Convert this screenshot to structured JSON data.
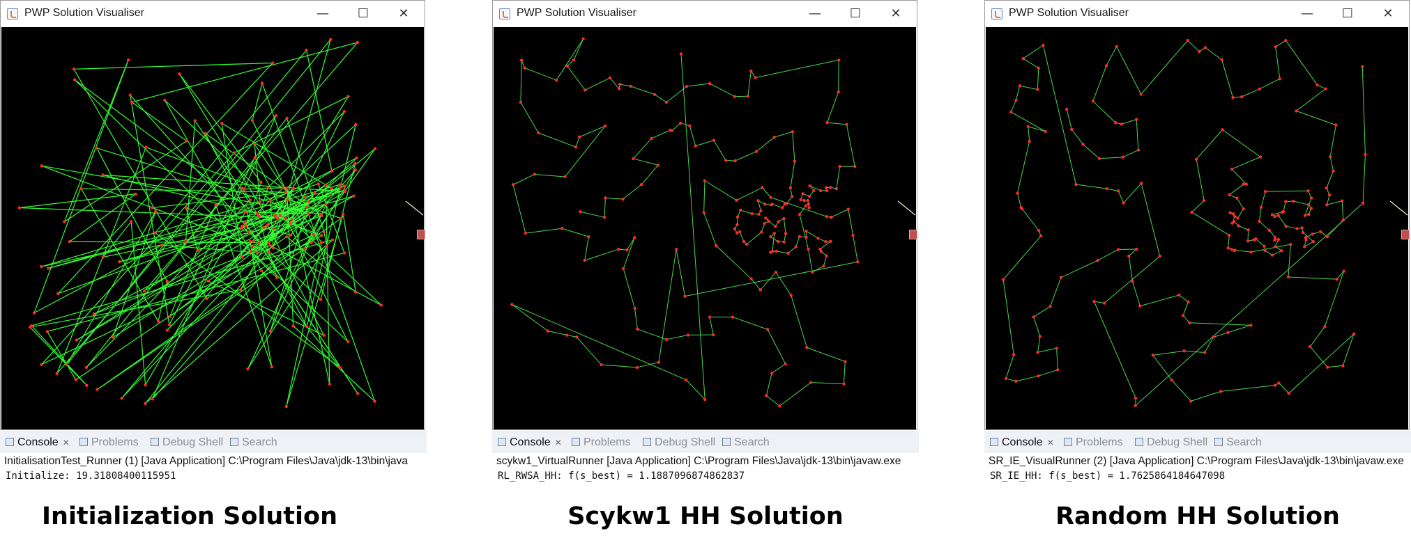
{
  "windows": [
    {
      "title": "PWP Solution Visualiser",
      "console_tab": "Console",
      "problems_tab": "Problems",
      "debug_tab": "Debug Shell",
      "search_tab": "Search",
      "launch_line": "InitialisationTest_Runner (1) [Java Application] C:\\Program Files\\Java\\jdk-13\\bin\\java",
      "output_line": "Initialize: 19.31808400115951",
      "caption": "Initialization Solution",
      "style": "random",
      "colors": {
        "edge": "#33ff33",
        "node": "#ff2a2a",
        "bg": "#000000"
      }
    },
    {
      "title": "PWP Solution Visualiser",
      "console_tab": "Console",
      "problems_tab": "Problems",
      "debug_tab": "Debug Shell",
      "search_tab": "Search",
      "launch_line": "scykw1_VirtualRunner [Java Application] C:\\Program Files\\Java\\jdk-13\\bin\\javaw.exe",
      "output_line": "RL_RWSA_HH: f(s_best) = 1.1887096874862837",
      "caption": "Scykw1 HH Solution",
      "style": "tour",
      "colors": {
        "edge": "#4cd94c",
        "node": "#ff2a2a",
        "bg": "#000000"
      }
    },
    {
      "title": "PWP Solution Visualiser",
      "console_tab": "Console",
      "problems_tab": "Problems",
      "debug_tab": "Debug Shell",
      "search_tab": "Search",
      "launch_line": "SR_IE_VisualRunner (2) [Java Application] C:\\Program Files\\Java\\jdk-13\\bin\\javaw.exe",
      "output_line": "SR_IE_HH: f(s_best) = 1.7625864184647098",
      "caption": "Random HH Solution",
      "style": "tour2",
      "colors": {
        "edge": "#4cd94c",
        "node": "#ff2a2a",
        "bg": "#000000"
      }
    }
  ],
  "window_buttons": {
    "minimize": "—",
    "maximize": "☐",
    "close": "✕"
  }
}
